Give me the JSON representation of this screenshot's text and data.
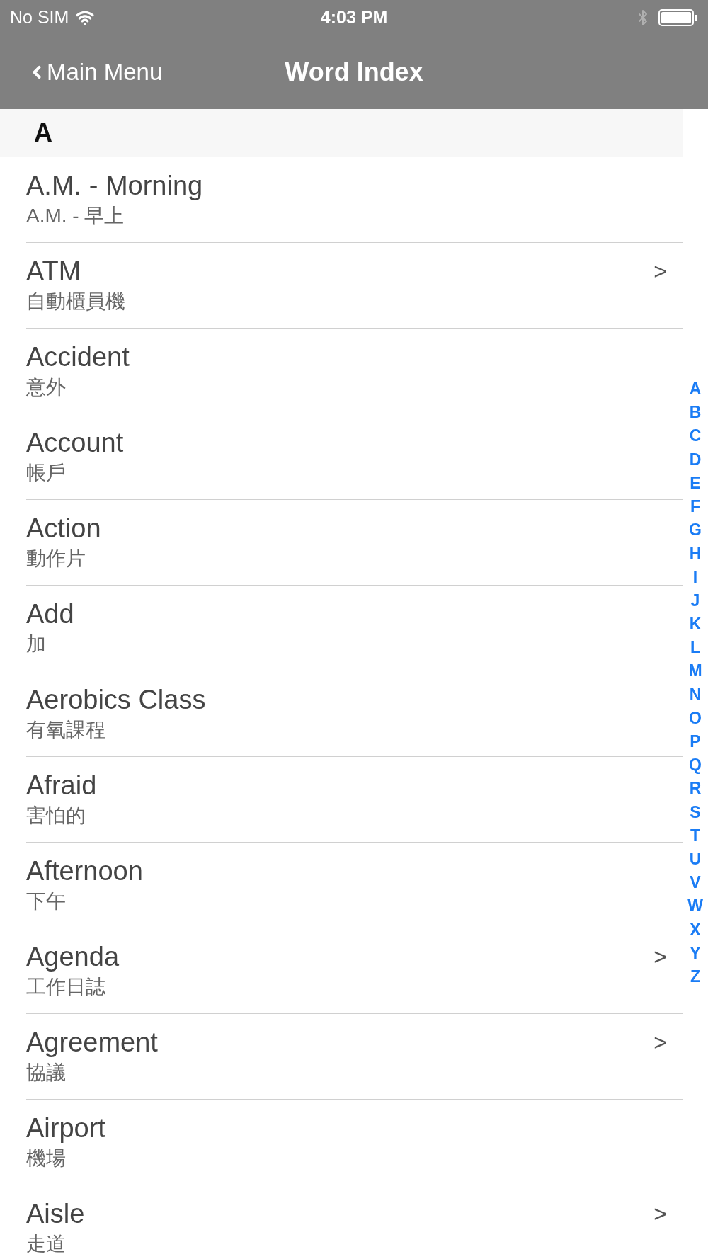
{
  "status_bar": {
    "carrier": "No SIM",
    "time": "4:03 PM"
  },
  "nav_bar": {
    "back_label": "Main Menu",
    "title": "Word Index"
  },
  "section": {
    "header": "A",
    "rows": [
      {
        "title": "A.M. - Morning",
        "subtitle": "A.M. - 早上"
      },
      {
        "title": "ATM",
        "subtitle": "自動櫃員機",
        "accessory": ">"
      },
      {
        "title": "Accident",
        "subtitle": "意外"
      },
      {
        "title": "Account",
        "subtitle": "帳戶"
      },
      {
        "title": "Action",
        "subtitle": "動作片"
      },
      {
        "title": "Add",
        "subtitle": "加"
      },
      {
        "title": "Aerobics Class",
        "subtitle": "有氧課程"
      },
      {
        "title": "Afraid",
        "subtitle": "害怕的"
      },
      {
        "title": "Afternoon",
        "subtitle": "下午"
      },
      {
        "title": "Agenda",
        "subtitle": "工作日誌",
        "accessory": ">"
      },
      {
        "title": "Agreement",
        "subtitle": "協議",
        "accessory": ">"
      },
      {
        "title": "Airport",
        "subtitle": "機場"
      },
      {
        "title": "Aisle",
        "subtitle": "走道",
        "accessory": ">"
      }
    ]
  },
  "index": [
    "A",
    "B",
    "C",
    "D",
    "E",
    "F",
    "G",
    "H",
    "I",
    "J",
    "K",
    "L",
    "M",
    "N",
    "O",
    "P",
    "Q",
    "R",
    "S",
    "T",
    "U",
    "V",
    "W",
    "X",
    "Y",
    "Z"
  ]
}
